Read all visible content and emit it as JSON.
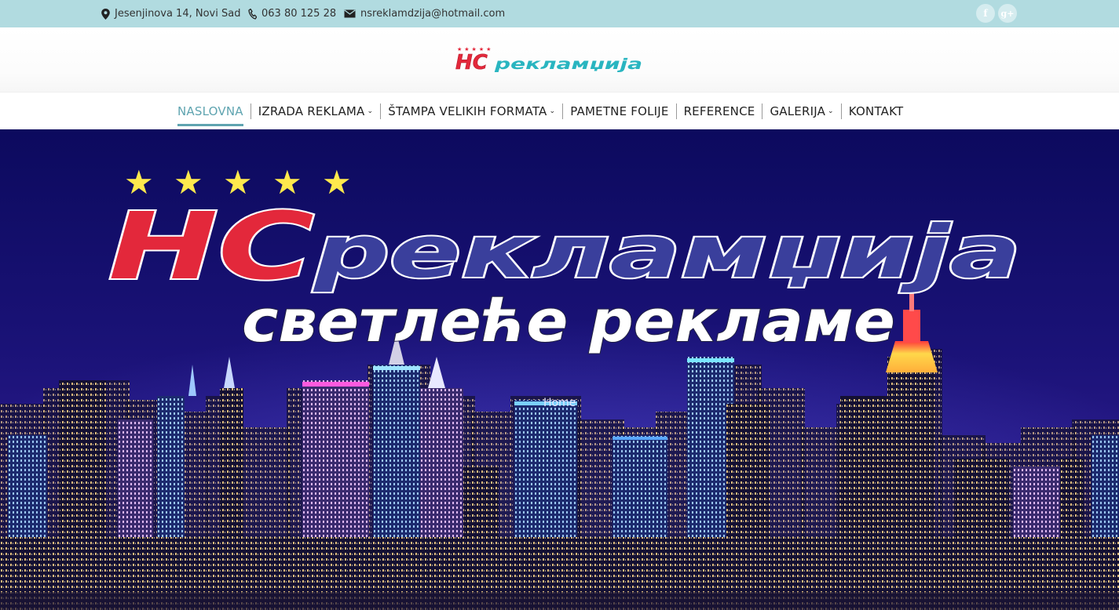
{
  "topbar": {
    "address": "Jesenjinova 14, Novi Sad",
    "phone": "063 80 125 28",
    "email": "nsreklamdzija@hotmail.com",
    "social": [
      {
        "icon": "facebook-icon",
        "glyph": "f"
      },
      {
        "icon": "google-plus-icon",
        "glyph": "g+"
      }
    ]
  },
  "logo": {
    "brand_latin": "HC",
    "brand_cyrillic": "рекламџија",
    "stars": "★★★★★"
  },
  "nav": {
    "items": [
      {
        "label": "NASLOVNA",
        "active": true,
        "dropdown": false
      },
      {
        "label": "IZRADA REKLAMA",
        "active": false,
        "dropdown": true
      },
      {
        "label": "ŠTAMPA VELIKIH FORMATA",
        "active": false,
        "dropdown": true
      },
      {
        "label": "PAMETNE FOLIJE",
        "active": false,
        "dropdown": false
      },
      {
        "label": "REFERENCE",
        "active": false,
        "dropdown": false
      },
      {
        "label": "GALERIJA",
        "active": false,
        "dropdown": true
      },
      {
        "label": "KONTAKT",
        "active": false,
        "dropdown": false
      }
    ],
    "caret": "⌄"
  },
  "hero": {
    "stars": "★ ★ ★ ★ ★",
    "brand_latin": "HC",
    "brand_cyrillic": "рекламџија",
    "tagline": "светлеће рекламе",
    "slide_label": "Home"
  },
  "colors": {
    "topbar_bg": "#b1dbe0",
    "accent": "#5fa4b0",
    "brand_red": "#e3283b",
    "brand_blue": "#3a3f9c",
    "star_yellow": "#ffe94d",
    "sky_top": "#0c0a5e",
    "sky_bottom": "#2a1a8a"
  }
}
